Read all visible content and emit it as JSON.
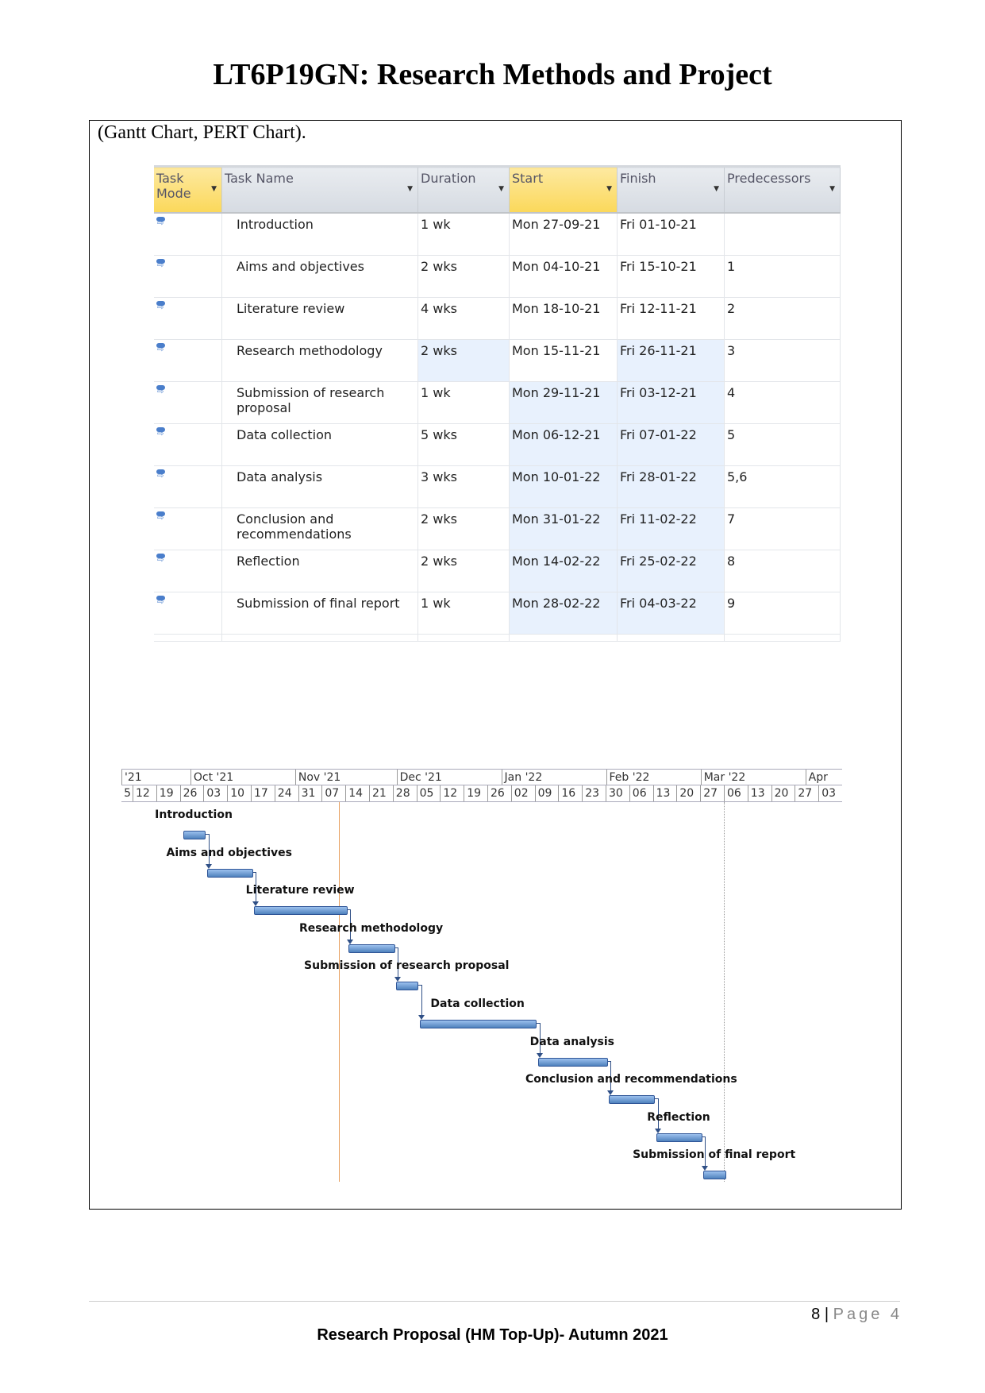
{
  "header": {
    "title": "LT6P19GN: Research Methods and Project"
  },
  "caption": "(Gantt Chart, PERT Chart).",
  "table": {
    "columns": [
      "Task Mode",
      "Task Name",
      "Duration",
      "Start",
      "Finish",
      "Predecessors"
    ],
    "rows": [
      {
        "name": "Introduction",
        "duration": "1 wk",
        "start": "Mon 27-09-21",
        "finish": "Fri 01-10-21",
        "pred": ""
      },
      {
        "name": "Aims and objectives",
        "duration": "2 wks",
        "start": "Mon 04-10-21",
        "finish": "Fri 15-10-21",
        "pred": "1"
      },
      {
        "name": "Literature review",
        "duration": "4 wks",
        "start": "Mon 18-10-21",
        "finish": "Fri 12-11-21",
        "pred": "2"
      },
      {
        "name": "Research methodology",
        "duration": "2 wks",
        "start": "Mon 15-11-21",
        "finish": "Fri 26-11-21",
        "pred": "3"
      },
      {
        "name": "Submission of research proposal",
        "duration": "1 wk",
        "start": "Mon 29-11-21",
        "finish": "Fri 03-12-21",
        "pred": "4"
      },
      {
        "name": "Data collection",
        "duration": "5 wks",
        "start": "Mon 06-12-21",
        "finish": "Fri 07-01-22",
        "pred": "5"
      },
      {
        "name": "Data analysis",
        "duration": "3 wks",
        "start": "Mon 10-01-22",
        "finish": "Fri 28-01-22",
        "pred": "5,6"
      },
      {
        "name": "Conclusion and recommendations",
        "duration": "2 wks",
        "start": "Mon 31-01-22",
        "finish": "Fri 11-02-22",
        "pred": "7"
      },
      {
        "name": "Reflection",
        "duration": "2 wks",
        "start": "Mon 14-02-22",
        "finish": "Fri 25-02-22",
        "pred": "8"
      },
      {
        "name": "Submission of final report",
        "duration": "1 wk",
        "start": "Mon 28-02-22",
        "finish": "Fri 04-03-22",
        "pred": "9"
      }
    ]
  },
  "gantt": {
    "months": [
      "'21",
      "Oct '21",
      "Nov '21",
      "Dec '21",
      "Jan '22",
      "Feb '22",
      "Mar '22",
      "Apr"
    ],
    "weeks": [
      "5",
      "12",
      "19",
      "26",
      "03",
      "10",
      "17",
      "24",
      "31",
      "07",
      "14",
      "21",
      "28",
      "05",
      "12",
      "19",
      "26",
      "02",
      "09",
      "16",
      "23",
      "30",
      "06",
      "13",
      "20",
      "27",
      "06",
      "13",
      "20",
      "27",
      "03"
    ],
    "bar_color": "#4f81bd",
    "today_line_color": "#e8a060",
    "today_date": "2021-11-12",
    "tasks": [
      {
        "label": "Introduction",
        "start": "2021-09-27",
        "finish": "2021-10-01"
      },
      {
        "label": "Aims and objectives",
        "start": "2021-10-04",
        "finish": "2021-10-15"
      },
      {
        "label": "Literature review",
        "start": "2021-10-18",
        "finish": "2021-11-12"
      },
      {
        "label": "Research methodology",
        "start": "2021-11-15",
        "finish": "2021-11-26"
      },
      {
        "label": "Submission of research proposal",
        "start": "2021-11-29",
        "finish": "2021-12-03"
      },
      {
        "label": "Data collection",
        "start": "2021-12-06",
        "finish": "2022-01-07"
      },
      {
        "label": "Data analysis",
        "start": "2022-01-10",
        "finish": "2022-01-28"
      },
      {
        "label": "Conclusion and recommendations",
        "start": "2022-01-31",
        "finish": "2022-02-11"
      },
      {
        "label": "Reflection",
        "start": "2022-02-14",
        "finish": "2022-02-25"
      },
      {
        "label": "Submission of final report",
        "start": "2022-02-28",
        "finish": "2022-03-04"
      }
    ]
  },
  "footer": {
    "page_number": "8",
    "page_label": "Page 4",
    "text": "Research Proposal (HM Top-Up)- Autumn 2021"
  }
}
